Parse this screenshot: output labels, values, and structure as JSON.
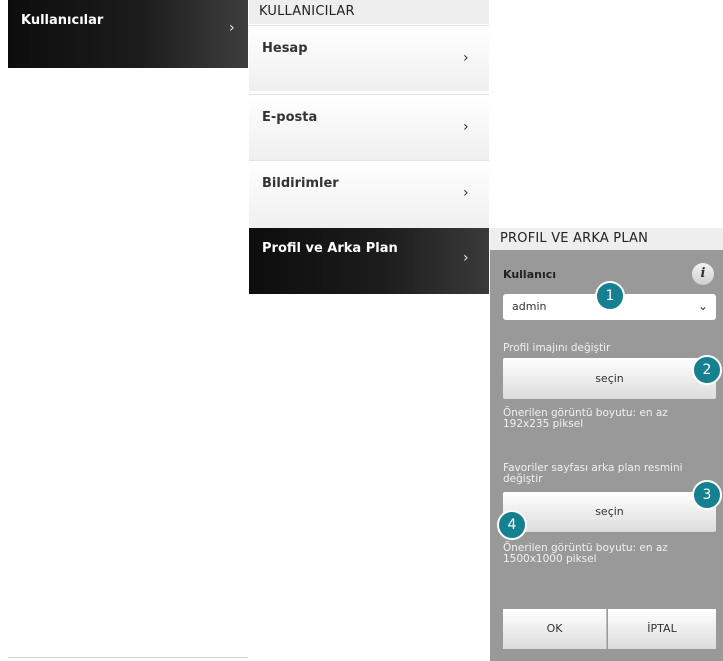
{
  "column1": {
    "item_label": "Kullanıcılar",
    "chevron": "›"
  },
  "column2": {
    "header": "KULLANICILAR",
    "items": [
      {
        "label": "Hesap",
        "chevron": "›"
      },
      {
        "label": "E-posta",
        "chevron": "›"
      },
      {
        "label": "Bildirimler",
        "chevron": "›"
      },
      {
        "label": "Profil ve Arka Plan",
        "chevron": "›"
      }
    ]
  },
  "column3": {
    "header": "PROFIL VE ARKA PLAN",
    "user_label": "Kullanıcı",
    "info_icon": "i",
    "user_select": {
      "value": "admin",
      "caret": "⌄"
    },
    "profile_image": {
      "label": "Profil imajını değiştir",
      "button": "seçin",
      "hint": "Önerilen görüntü boyutu: en az 192x235 piksel"
    },
    "favorites_bg": {
      "label": "Favoriler sayfası arka plan resmini değiştir",
      "button": "seçin",
      "hint": "Önerilen görüntü boyutu: en az 1500x1000 piksel"
    },
    "ok": "OK",
    "cancel": "İPTAL"
  },
  "callouts": [
    "1",
    "2",
    "3",
    "4"
  ],
  "colors": {
    "dark_gradient_start": "#0d0d0d",
    "panel_gray": "#999999",
    "callout_teal": "#15808f",
    "header_bg": "#eeeeee"
  }
}
